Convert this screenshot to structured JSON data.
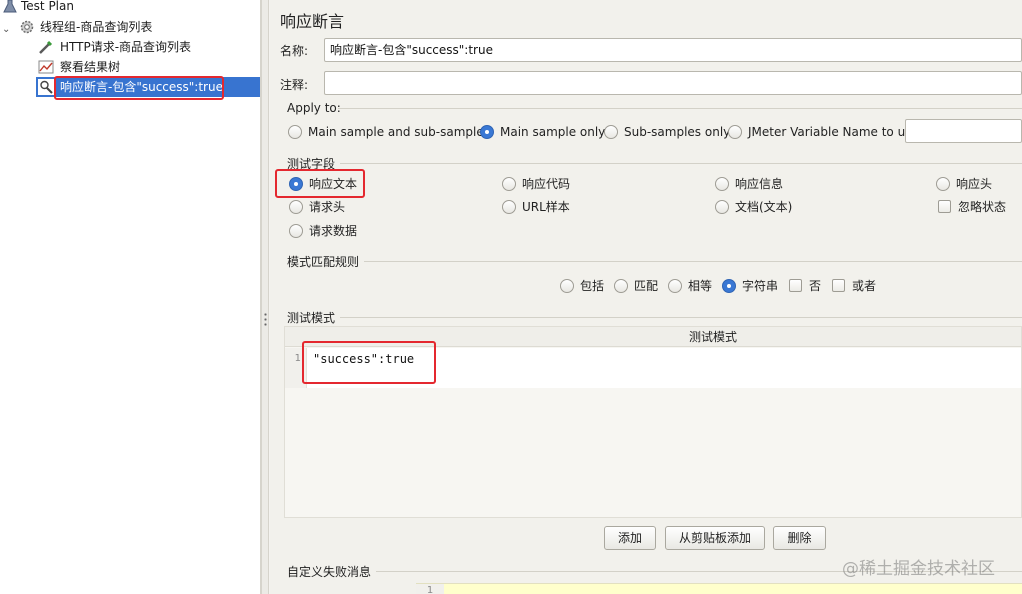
{
  "tree": {
    "test_plan": "Test Plan",
    "thread_group": "线程组-商品查询列表",
    "http_request": "HTTP请求-商品查询列表",
    "result_tree": "察看结果树",
    "assertion": "响应断言-包含\"success\":true"
  },
  "panel": {
    "title": "响应断言",
    "name_label": "名称:",
    "name_value": "响应断言-包含\"success\":true",
    "comment_label": "注释:",
    "comment_value": "",
    "apply_to": {
      "label": "Apply to:",
      "options": [
        "Main sample and sub-samples",
        "Main sample only",
        "Sub-samples only",
        "JMeter Variable Name to use"
      ],
      "selected": "Main sample only",
      "variable_value": ""
    },
    "test_field": {
      "label": "测试字段",
      "options": [
        "响应文本",
        "响应代码",
        "响应信息",
        "响应头",
        "请求头",
        "URL样本",
        "文档(文本)",
        "请求数据"
      ],
      "selected": "响应文本",
      "ignore_status": "忽略状态"
    },
    "pattern_rules": {
      "label": "模式匹配规则",
      "options": [
        "包括",
        "匹配",
        "相等",
        "字符串"
      ],
      "selected": "字符串",
      "not_label": "否",
      "or_label": "或者"
    },
    "test_patterns": {
      "label": "测试模式",
      "column_header": "测试模式",
      "line_number": "1",
      "value": "\"success\":true"
    },
    "buttons": {
      "add": "添加",
      "add_clipboard": "从剪贴板添加",
      "delete": "删除"
    },
    "custom_failure": {
      "label": "自定义失败消息",
      "line_number": "1"
    }
  },
  "watermark": "@稀土掘金技术社区",
  "colors": {
    "selection": "#3874d0",
    "highlight_box": "#e4282f",
    "radio_on": "#3a78d4",
    "editor_yellow": "#ffffcc"
  }
}
